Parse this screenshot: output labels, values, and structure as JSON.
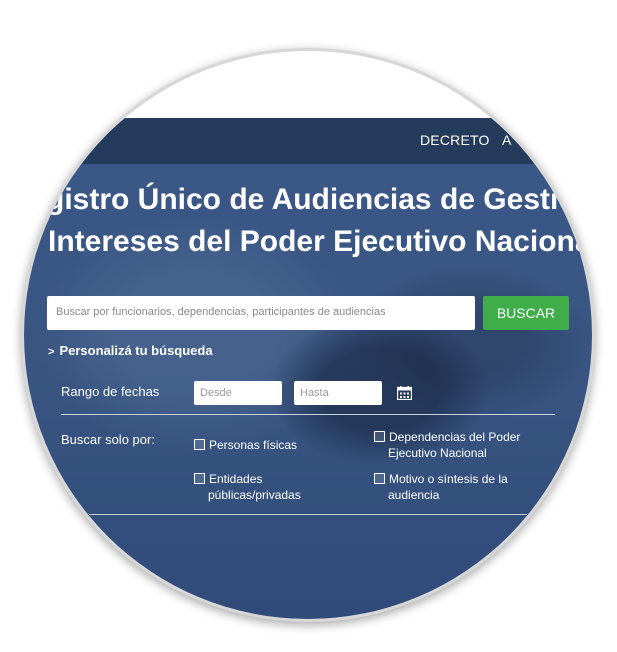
{
  "nav": {
    "items": [
      "DECRETO",
      "A"
    ]
  },
  "hero": {
    "title_line1": "gistro Único de Audiencias de Gestión",
    "title_line2": "Intereses del Poder Ejecutivo Nacional"
  },
  "search": {
    "placeholder": "Buscar por funcionarios, dependencias, participantes de audiencias",
    "button_label": "BUSCAR"
  },
  "filters": {
    "personalize_label": "Personalizá tu búsqueda",
    "date_range_label": "Rango de fechas",
    "desde_placeholder": "Desde",
    "hasta_placeholder": "Hasta",
    "search_only_label": "Buscar solo por:",
    "options": [
      {
        "label": "Personas físicas"
      },
      {
        "label": "Dependencias del Poder Ejecutivo Nacional"
      },
      {
        "label": "Entidades públicas/privadas"
      },
      {
        "label": "Motivo o síntesis de la audiencia"
      }
    ]
  },
  "icons": {
    "calendar": "calendar-icon",
    "chevron": "chevron-right-icon"
  },
  "colors": {
    "navbar": "#253b5b",
    "hero": "#3a5787",
    "button": "#3fae49"
  }
}
